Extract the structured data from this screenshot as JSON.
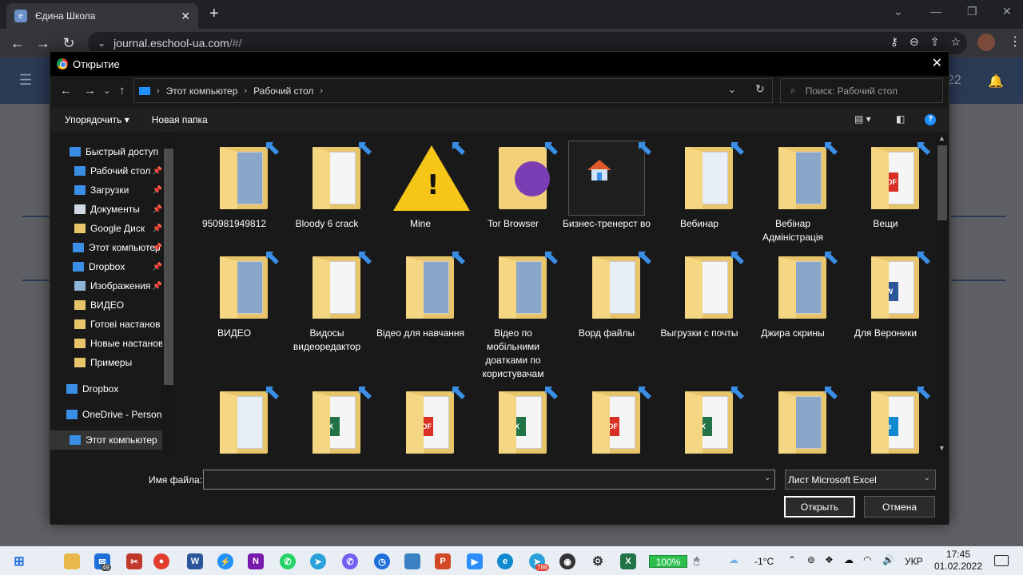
{
  "browser": {
    "tab_title": "Єдина Школа",
    "url_host": "journal.eschool-ua.com",
    "url_path": "/#/"
  },
  "page": {
    "date_fragment": "22"
  },
  "dialog": {
    "title": "Открытие",
    "breadcrumb": [
      "Этот компьютер",
      "Рабочий стол"
    ],
    "search_placeholder": "Поиск: Рабочий стол",
    "organize_label": "Упорядочить ▾",
    "new_folder_label": "Новая папка",
    "nav_items": [
      {
        "label": "Быстрый доступ",
        "icon": "star-icon",
        "color": "#3a8ee6",
        "pinned": false
      },
      {
        "label": "Рабочий стол",
        "icon": "desktop-icon",
        "color": "#3a8ee6",
        "pinned": true
      },
      {
        "label": "Загрузки",
        "icon": "download-icon",
        "color": "#3a8ee6",
        "pinned": true
      },
      {
        "label": "Документы",
        "icon": "documents-icon",
        "color": "#cfd8e3",
        "pinned": true
      },
      {
        "label": "Google Диск",
        "icon": "folder-icon",
        "color": "#e8c56a",
        "pinned": true
      },
      {
        "label": "Этот компьютер",
        "icon": "computer-icon",
        "color": "#3a8ee6",
        "pinned": true
      },
      {
        "label": "Dropbox",
        "icon": "dropbox-icon",
        "color": "#3a8ee6",
        "pinned": true
      },
      {
        "label": "Изображения",
        "icon": "pictures-icon",
        "color": "#8fb6d8",
        "pinned": true
      },
      {
        "label": "ВИДЕО",
        "icon": "folder-icon",
        "color": "#e8c56a",
        "pinned": false
      },
      {
        "label": "Готові настанов",
        "icon": "folder-icon",
        "color": "#e8c56a",
        "pinned": false
      },
      {
        "label": "Новые настанов",
        "icon": "folder-icon",
        "color": "#e8c56a",
        "pinned": false
      },
      {
        "label": "Примеры",
        "icon": "folder-icon",
        "color": "#e8c56a",
        "pinned": false
      },
      {
        "label": "Dropbox",
        "icon": "dropbox-icon",
        "color": "#3a8ee6",
        "pinned": false
      },
      {
        "label": "OneDrive - Person",
        "icon": "onedrive-icon",
        "color": "#3a8ee6",
        "pinned": false
      },
      {
        "label": "Этот компьютер",
        "icon": "computer-icon",
        "color": "#3a8ee6",
        "pinned": false
      }
    ],
    "files": [
      {
        "label": "950981949812",
        "kind": "folder-photo"
      },
      {
        "label": "Bloody 6 crack",
        "kind": "folder"
      },
      {
        "label": "Mine",
        "kind": "warning"
      },
      {
        "label": "Tor Browser",
        "kind": "tor"
      },
      {
        "label": "Бизнес-тренерст во",
        "kind": "selected-house"
      },
      {
        "label": "Вебинар",
        "kind": "folder-docs"
      },
      {
        "label": "Вебінар Адміністрація",
        "kind": "folder-photo"
      },
      {
        "label": "Вещи",
        "kind": "folder-pdf"
      },
      {
        "label": "ВИДЕО",
        "kind": "folder-photo"
      },
      {
        "label": "Видосы видеоредактор",
        "kind": "folder"
      },
      {
        "label": "Відео для навчання",
        "kind": "folder-photo"
      },
      {
        "label": "Відео по мобільними доатками по користувачам",
        "kind": "folder-photo"
      },
      {
        "label": "Ворд файлы",
        "kind": "folder-docs"
      },
      {
        "label": "Выгрузки с почты",
        "kind": "folder"
      },
      {
        "label": "Джира скрины",
        "kind": "folder-photo"
      },
      {
        "label": "Для Вероники",
        "kind": "folder-word"
      },
      {
        "label": "",
        "kind": "folder-docs"
      },
      {
        "label": "",
        "kind": "folder-excel"
      },
      {
        "label": "",
        "kind": "folder-pdf"
      },
      {
        "label": "",
        "kind": "folder-excel"
      },
      {
        "label": "",
        "kind": "folder-pdf"
      },
      {
        "label": "",
        "kind": "folder-excel"
      },
      {
        "label": "",
        "kind": "folder-photo"
      },
      {
        "label": "",
        "kind": "folder-edge"
      }
    ],
    "filename_label": "Имя файла:",
    "filename_value": "",
    "filetype_value": "Лист Microsoft Excel",
    "open_label": "Открыть",
    "cancel_label": "Отмена"
  },
  "taskbar": {
    "mail_badge": "49",
    "telegram_badge": "788",
    "battery": "100%",
    "temperature": "-1°C",
    "language": "УКР",
    "time": "17:45",
    "date": "01.02.2022"
  }
}
